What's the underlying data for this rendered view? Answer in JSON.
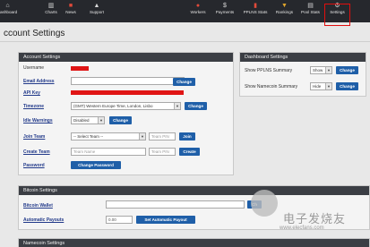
{
  "nav": {
    "left": [
      {
        "label": "ashboard",
        "icon": "home-icon"
      },
      {
        "label": "Charts",
        "icon": "chart-icon"
      },
      {
        "label": "News",
        "icon": "news-icon"
      },
      {
        "label": "Support",
        "icon": "support-icon"
      }
    ],
    "right": [
      {
        "label": "Workers",
        "icon": "workers-icon"
      },
      {
        "label": "Payments",
        "icon": "payments-icon"
      },
      {
        "label": "PPLNS Stats",
        "icon": "stats-icon"
      },
      {
        "label": "Rankings",
        "icon": "trophy-icon"
      },
      {
        "label": "Pool Stats",
        "icon": "pool-icon"
      },
      {
        "label": "Settings",
        "icon": "gear-icon"
      }
    ]
  },
  "page": {
    "title": "ccount Settings"
  },
  "account": {
    "heading": "Account Settings",
    "username_label": "Username",
    "email_label": "Email Address",
    "email_value": "",
    "email_button": "Change",
    "apikey_label": "API Key",
    "timezone_label": "Timezone",
    "timezone_value": "(GMT) Western Europe Time, London, Lisbo",
    "timezone_button": "Change",
    "idle_label": "Idle Warnings",
    "idle_value": "Disabled",
    "idle_button": "Change",
    "join_label": "Join Team",
    "join_value": "-- Select Team --",
    "join_pin_placeholder": "Team PIN",
    "join_button": "Join",
    "create_label": "Create Team",
    "create_name_placeholder": "Team Name",
    "create_pin_placeholder": "Team PIN",
    "create_button": "Create",
    "password_label": "Password",
    "password_button": "Change Password"
  },
  "dashboard": {
    "heading": "Dashboard Settings",
    "pplns_label": "Show PPLNS Summary",
    "pplns_value": "Show",
    "pplns_button": "Change",
    "namecoin_label": "Show Namecoin Summary",
    "namecoin_value": "Hide",
    "namecoin_button": "Change"
  },
  "bitcoin": {
    "heading": "Bitcoin Settings",
    "wallet_label": "Bitcoin Wallet",
    "wallet_value": "",
    "wallet_button": "Ch",
    "payout_label": "Automatic Payouts",
    "payout_value": "0.00",
    "payout_button": "Set Automatic Payout"
  },
  "next_panel": {
    "heading": "Namecoin Settings"
  },
  "watermark": {
    "cn": "电子发烧友",
    "url": "www.elecfans.com"
  },
  "colors": {
    "redaction": "#e01515",
    "button": "#1f5fa8",
    "highlight": "#e10e0e"
  }
}
